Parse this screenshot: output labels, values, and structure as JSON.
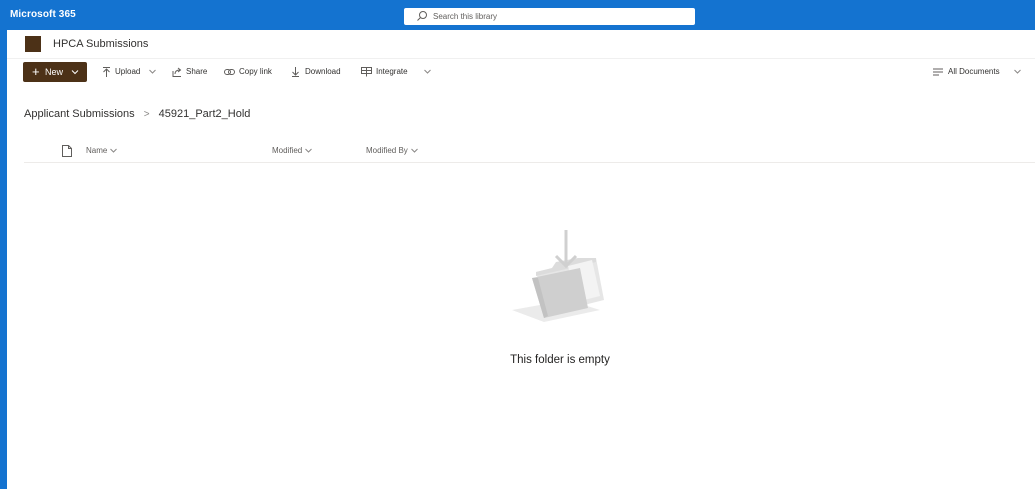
{
  "suite": {
    "brand": "Microsoft 365"
  },
  "search": {
    "placeholder": "Search this library"
  },
  "site": {
    "title": "HPCA Submissions",
    "logo_color": "#4c3117"
  },
  "commands": {
    "new": "New",
    "upload": "Upload",
    "share": "Share",
    "copy_link": "Copy link",
    "download": "Download",
    "integrate": "Integrate",
    "view": "All Documents"
  },
  "breadcrumb": {
    "parent": "Applicant Submissions",
    "separator": ">",
    "current": "45921_Part2_Hold"
  },
  "columns": {
    "name": "Name",
    "modified": "Modified",
    "modified_by": "Modified By"
  },
  "empty_state": {
    "message": "This folder is empty"
  },
  "colors": {
    "suite_bar": "#1473d0",
    "accent": "#4c3117"
  }
}
